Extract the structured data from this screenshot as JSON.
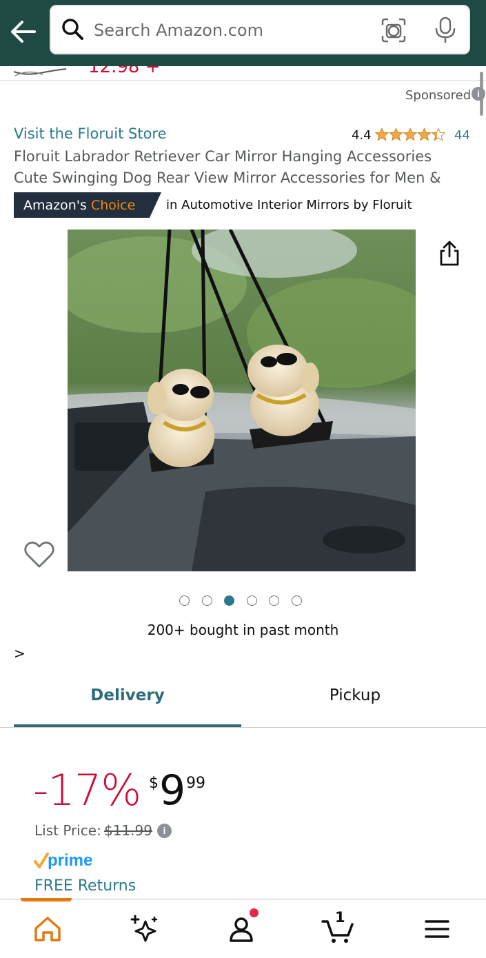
{
  "header": {
    "search_placeholder": "Search Amazon.com",
    "icons": [
      "back-arrow-icon",
      "search-icon",
      "camera-lens-icon",
      "microphone-icon"
    ],
    "brand_color": "#1f4a43"
  },
  "residual": {
    "price_fragment": "12.98 +"
  },
  "ad": {
    "sponsored_label": "Sponsored",
    "info_symbol": "i"
  },
  "product": {
    "store_link": "Visit the Floruit Store",
    "rating": "4.4",
    "stars_value": 4.4,
    "review_count": "44",
    "title": "Floruit Labrador Retriever Car Mirror Hanging Accessories Cute Swinging Dog Rear View Mirror Accessories for Men & Women",
    "choice_prefix": "Amazon's",
    "choice_word": "Choice",
    "choice_category": "in Automotive Interior Mirrors by Floruit",
    "image_count": 6,
    "image_active_index": 2,
    "bought_text": "200+ bought in past month",
    "chevron": ">"
  },
  "tabs": [
    {
      "label": "Delivery",
      "active": true
    },
    {
      "label": "Pickup",
      "active": false
    }
  ],
  "pricing": {
    "discount": "-17%",
    "currency": "$",
    "whole": "9",
    "fraction": "99",
    "list_price_label": "List Price:",
    "list_price_value": "$11.99",
    "info_symbol": "i",
    "prime_label": "prime",
    "free_returns": "FREE Returns"
  },
  "bottom_nav": {
    "items": [
      "home-icon",
      "ai-sparkle-icon",
      "account-icon",
      "cart-icon",
      "menu-icon"
    ],
    "active": "home-icon",
    "cart_count": "1",
    "accent": "#e47911"
  },
  "colors": {
    "link": "#2a7a8c",
    "price_red": "#cc0c39",
    "prime_blue": "#1a98ff",
    "star": "#f3a847"
  }
}
